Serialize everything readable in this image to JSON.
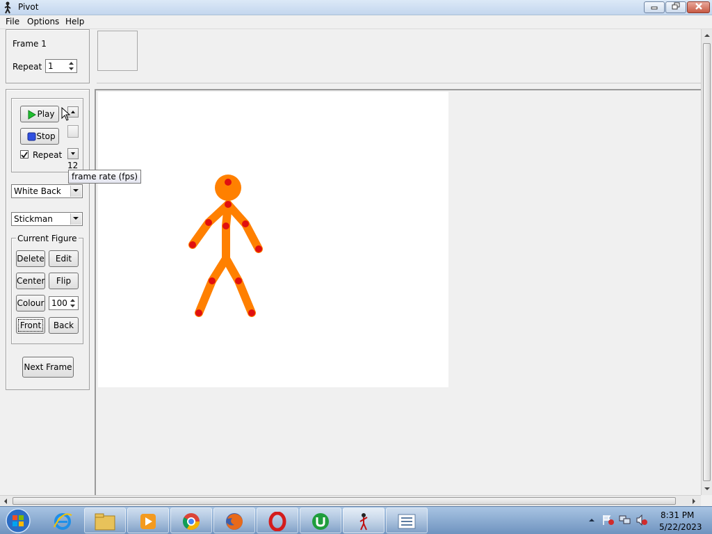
{
  "window": {
    "title": "Pivot"
  },
  "menu": [
    "File",
    "Options",
    "Help"
  ],
  "frame_panel": {
    "frame_label": "Frame 1",
    "repeat_label": "Repeat :",
    "repeat_value": "1"
  },
  "playback": {
    "play_label": "Play",
    "stop_label": "Stop",
    "repeat_label": "Repeat",
    "repeat_checked": true,
    "fps_value": "12",
    "fps_tooltip": "frame rate (fps)"
  },
  "background_select": {
    "value": "White Back"
  },
  "figure_select": {
    "value": "Stickman"
  },
  "current_figure": {
    "group_label": "Current Figure",
    "delete_label": "Delete",
    "edit_label": "Edit",
    "center_label": "Center",
    "flip_label": "Flip",
    "colour_label": "Colour",
    "colour_value": "100",
    "front_label": "Front",
    "back_label": "Back"
  },
  "next_frame_label": "Next Frame",
  "colors": {
    "figure": "#ff8000",
    "joint": "#e01010",
    "canvas": "#ffffff"
  },
  "taskbar": {
    "apps": [
      "start-orb",
      "internet-explorer",
      "file-explorer",
      "media-player",
      "chrome",
      "firefox",
      "opera",
      "utorrent",
      "pivot",
      "notes"
    ],
    "time": "8:31 PM",
    "date": "5/22/2023"
  }
}
